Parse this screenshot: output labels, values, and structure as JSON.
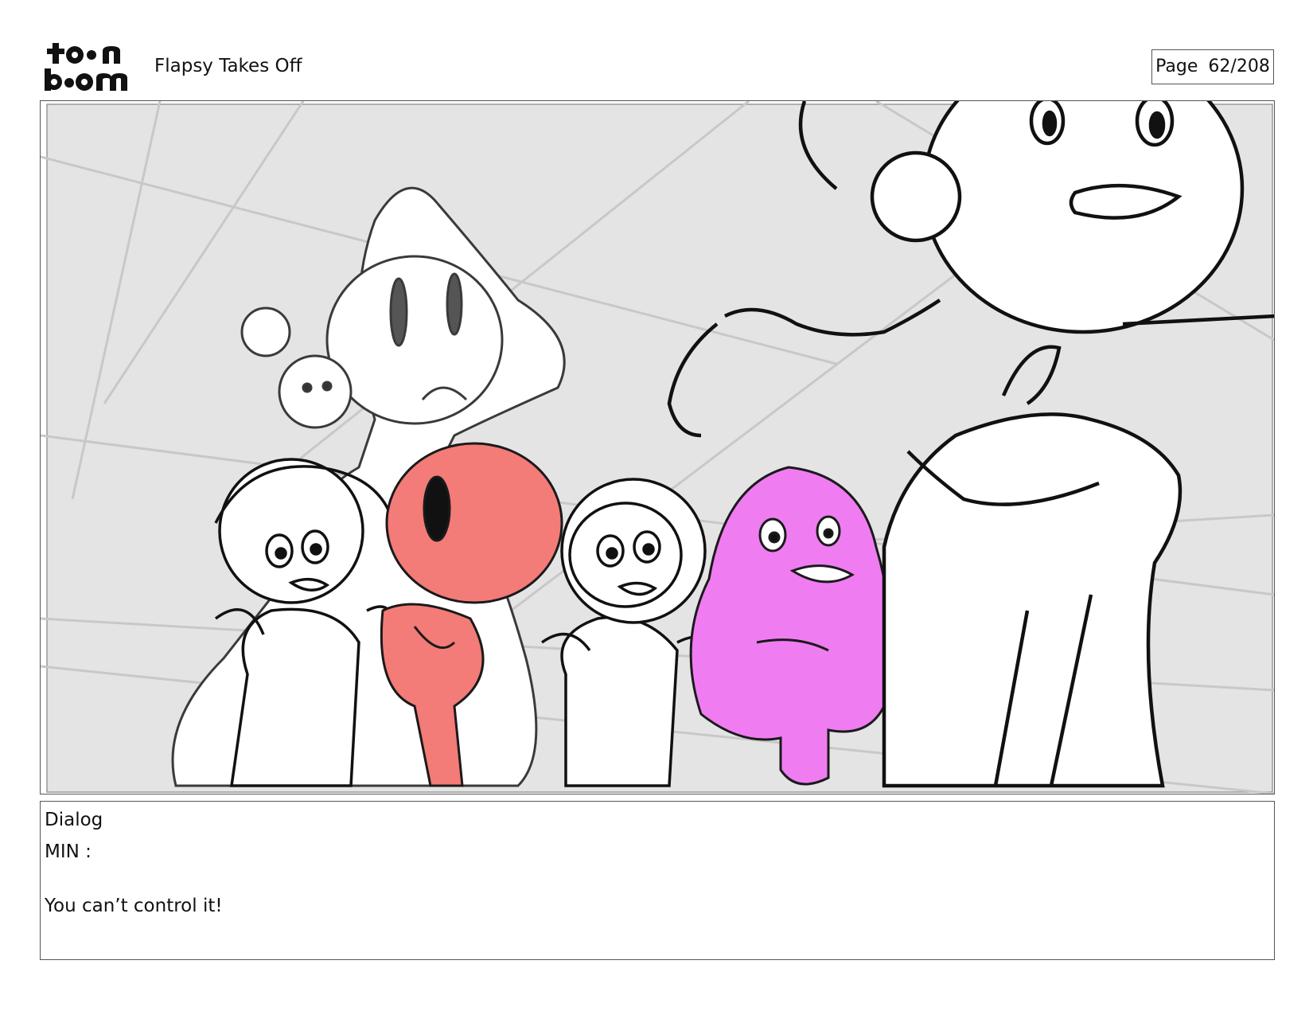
{
  "header": {
    "logo_text": "toon boom",
    "project_title": "Flapsy Takes Off",
    "page_label": "Page",
    "page_number": "62/208"
  },
  "panel": {
    "background_color": "#e4e4e4",
    "character_colors": {
      "red_character": "#f37b78",
      "pink_character": "#f07cf2"
    }
  },
  "dialog": {
    "heading": "Dialog",
    "speaker": "MIN :",
    "line": "You can’t control it!"
  }
}
